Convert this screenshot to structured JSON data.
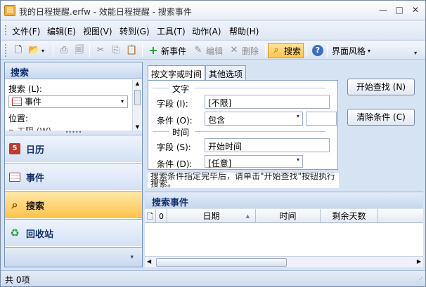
{
  "window": {
    "title": "我的日程提醒.erfw - 效能日程提醒 - 搜索事件"
  },
  "menubar": {
    "items": [
      "文件(F)",
      "编辑(E)",
      "视图(V)",
      "转到(G)",
      "工具(T)",
      "动作(A)",
      "帮助(H)"
    ]
  },
  "toolbar": {
    "new_event": "新事件",
    "edit": "编辑",
    "delete": "删除",
    "search": "搜索",
    "theme": "界面风格"
  },
  "left_pane": {
    "header": "搜索",
    "search_label": "搜索 (L):",
    "search_value": "事件",
    "location_label": "位置:",
    "location_value": "▫ 工限 (W)",
    "nav": [
      "日历",
      "事件",
      "搜索",
      "回收站"
    ]
  },
  "search_form": {
    "tabs": [
      "按文字或时间",
      "其他选项"
    ],
    "group_text": "文字",
    "field_label": "字段 (I):",
    "field_value": "[不限]",
    "condition_label": "条件 (O):",
    "condition_value": "包含",
    "group_time": "时间",
    "time_field_label": "字段 (S):",
    "time_field_value": "开始时间",
    "time_condition_label": "条件 (D):",
    "time_condition_value": "[任意]",
    "hint": "搜索条件指定完毕后，请单击\"开始查找\"按钮执行搜索。"
  },
  "actions": {
    "start_search": "开始查找 (N)",
    "clear": "清除条件 (C)"
  },
  "results": {
    "header": "搜索事件",
    "columns": [
      "日期",
      "时间",
      "剩余天数"
    ]
  },
  "status": {
    "text": "共 0项"
  }
}
